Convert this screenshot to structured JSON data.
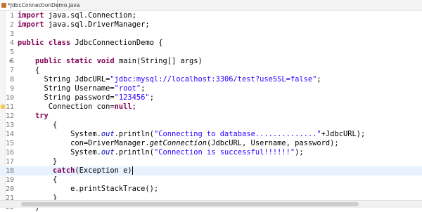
{
  "tab": {
    "title": "*JdbcConnectionDemo.java"
  },
  "lines": [
    {
      "n": "1",
      "tokens": [
        [
          "kw",
          "import"
        ],
        [
          "t",
          " java.sql.Connection;"
        ]
      ]
    },
    {
      "n": "2",
      "tokens": [
        [
          "kw",
          "import"
        ],
        [
          "t",
          " java.sql.DriverManager;"
        ]
      ]
    },
    {
      "n": "3",
      "tokens": []
    },
    {
      "n": "4",
      "tokens": [
        [
          "kw",
          "public"
        ],
        [
          "t",
          " "
        ],
        [
          "kw",
          "class"
        ],
        [
          "t",
          " JdbcConnectionDemo {"
        ]
      ]
    },
    {
      "n": "5",
      "tokens": []
    },
    {
      "n": "6",
      "tokens": [
        [
          "t",
          "    "
        ],
        [
          "kw",
          "public"
        ],
        [
          "t",
          " "
        ],
        [
          "kw",
          "static"
        ],
        [
          "t",
          " "
        ],
        [
          "kw",
          "void"
        ],
        [
          "t",
          " main(String[] args)"
        ]
      ]
    },
    {
      "n": "7",
      "tokens": [
        [
          "t",
          "    {"
        ]
      ]
    },
    {
      "n": "8",
      "tokens": [
        [
          "t",
          "      String JdbcURL="
        ],
        [
          "str",
          "\"jdbc:mysql://localhost:3306/test?useSSL=false\""
        ],
        [
          "t",
          ";"
        ]
      ]
    },
    {
      "n": "9",
      "tokens": [
        [
          "t",
          "      String Username="
        ],
        [
          "str",
          "\"root\""
        ],
        [
          "t",
          ";"
        ]
      ]
    },
    {
      "n": "10",
      "tokens": [
        [
          "t",
          "      String password="
        ],
        [
          "str",
          "\"123456\""
        ],
        [
          "t",
          ";"
        ]
      ]
    },
    {
      "n": "11",
      "tokens": [
        [
          "t",
          "       Connection con="
        ],
        [
          "kw",
          "null"
        ],
        [
          "t",
          ";"
        ]
      ]
    },
    {
      "n": "12",
      "tokens": [
        [
          "t",
          "    "
        ],
        [
          "kw",
          "try"
        ]
      ]
    },
    {
      "n": "13",
      "tokens": [
        [
          "t",
          "        {"
        ]
      ]
    },
    {
      "n": "14",
      "tokens": [
        [
          "t",
          "            System."
        ],
        [
          "field",
          "out"
        ],
        [
          "t",
          ".println("
        ],
        [
          "str",
          "\"Connecting to database..............\""
        ],
        [
          "t",
          "+JdbcURL);"
        ]
      ]
    },
    {
      "n": "15",
      "tokens": [
        [
          "t",
          "            con=DriverManager."
        ],
        [
          "it",
          "getConnection"
        ],
        [
          "t",
          "(JdbcURL, Username, password);"
        ]
      ]
    },
    {
      "n": "16",
      "tokens": [
        [
          "t",
          "            System."
        ],
        [
          "field",
          "out"
        ],
        [
          "t",
          ".println("
        ],
        [
          "str",
          "\"Connection is successful!!!!!!\""
        ],
        [
          "t",
          ");"
        ]
      ]
    },
    {
      "n": "17",
      "tokens": [
        [
          "t",
          "        }"
        ]
      ]
    },
    {
      "n": "18",
      "tokens": [
        [
          "t",
          "        "
        ],
        [
          "kw",
          "catch"
        ],
        [
          "t",
          "(Exception e)"
        ],
        [
          "cursor",
          ""
        ]
      ],
      "current": true
    },
    {
      "n": "19",
      "tokens": [
        [
          "t",
          "        {"
        ]
      ]
    },
    {
      "n": "20",
      "tokens": [
        [
          "t",
          "            e.printStackTrace();"
        ]
      ]
    },
    {
      "n": "21",
      "tokens": [
        [
          "t",
          "        }"
        ]
      ]
    },
    {
      "n": "22",
      "tokens": [
        [
          "t",
          "    }"
        ]
      ]
    }
  ]
}
